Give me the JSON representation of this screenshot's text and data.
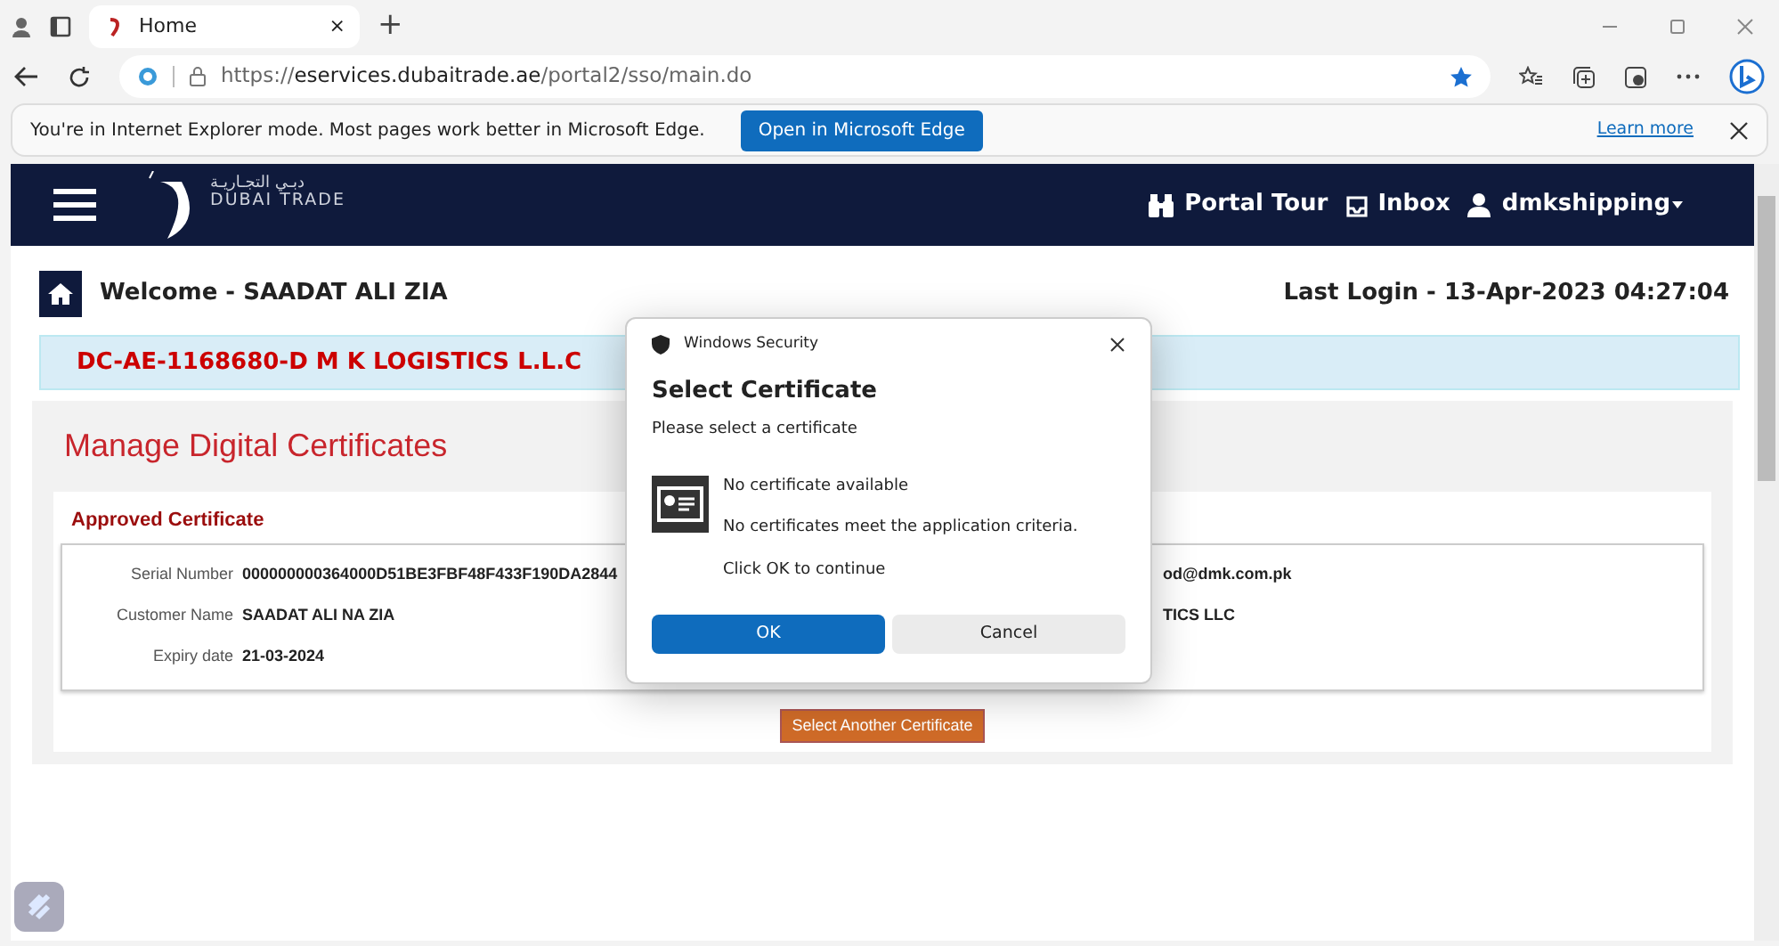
{
  "browser": {
    "tab": {
      "title": "Home",
      "selected": true
    },
    "tab_close": "×",
    "new_tab": "+",
    "url_scheme": "https://",
    "url_host": "eservices.dubaitrade.ae",
    "url_path": "/portal2/sso/main.do",
    "favorite": true
  },
  "ie_bar": {
    "message": "You're in Internet Explorer mode. Most pages work better in Microsoft Edge.",
    "button": "Open in Microsoft Edge",
    "link": "Learn more"
  },
  "site": {
    "logo_text": "DUBAI TRADE",
    "logo_arabic": "دبـي التجـاريـة",
    "nav": [
      {
        "label": "Portal Tour",
        "kind": "tour"
      },
      {
        "label": "Inbox",
        "kind": "inbox"
      },
      {
        "label": "dmkshipping",
        "kind": "user"
      }
    ]
  },
  "welcome": "Welcome - SAADAT ALI ZIA",
  "last_login": "Last Login - 13-Apr-2023 04:27:04",
  "company": "DC-AE-1168680-D M K LOGISTICS L.L.C",
  "panel_title": "Manage Digital Certificates",
  "certificate": {
    "heading": "Approved Certificate",
    "rows": [
      {
        "label": "Serial Number",
        "value": "000000000364000D51BE3FBF48F433F190DA2844",
        "value_2": "od@dmk.com.pk"
      },
      {
        "label": "Customer Name",
        "value": "SAADAT ALI NA ZIA",
        "value_2": "TICS LLC"
      },
      {
        "label": "Expiry date",
        "value": "21-03-2024"
      }
    ],
    "button": "Select Another Certificate"
  },
  "dialog": {
    "app": "Windows Security",
    "title": "Select Certificate",
    "prompt": "Please select a certificate",
    "lines": [
      "No certificate available",
      "No certificates meet the application criteria.",
      "Click OK to continue"
    ],
    "buttons": [
      {
        "label": "OK",
        "kind": "primary"
      },
      {
        "label": "Cancel",
        "kind": "secondary"
      }
    ]
  }
}
